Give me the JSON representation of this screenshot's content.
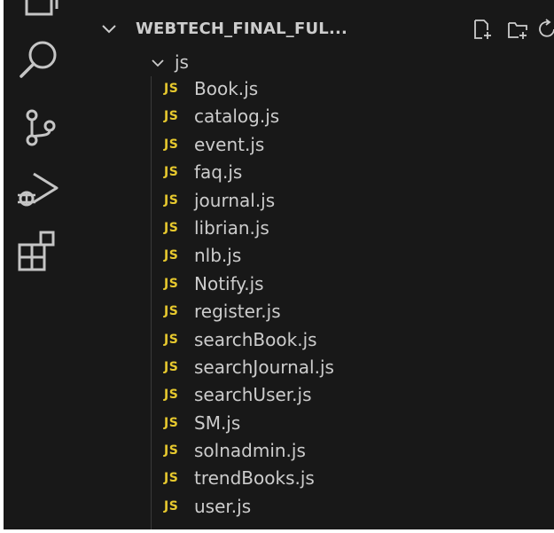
{
  "activity_bar": {
    "icons": [
      "files-icon",
      "search-icon",
      "source-control-icon",
      "run-debug-icon",
      "extensions-icon"
    ]
  },
  "explorer": {
    "section_title": "WEBTECH_FINAL_FUL...",
    "header_actions": [
      "new-file-icon",
      "new-folder-icon",
      "refresh-icon"
    ],
    "folder": {
      "name": "js",
      "expanded": true
    },
    "file_badge": "JS",
    "badge_color": "#e6c82e",
    "files": [
      {
        "name": "Book.js"
      },
      {
        "name": "catalog.js"
      },
      {
        "name": "event.js"
      },
      {
        "name": "faq.js"
      },
      {
        "name": "journal.js"
      },
      {
        "name": "librian.js"
      },
      {
        "name": "nlb.js"
      },
      {
        "name": "Notify.js"
      },
      {
        "name": "register.js"
      },
      {
        "name": "searchBook.js"
      },
      {
        "name": "searchJournal.js"
      },
      {
        "name": "searchUser.js"
      },
      {
        "name": "SM.js"
      },
      {
        "name": "solnadmin.js"
      },
      {
        "name": "trendBooks.js"
      },
      {
        "name": "user.js"
      }
    ]
  },
  "colors": {
    "background": "#181818",
    "text": "#cccccc",
    "icon": "#c5c5c5"
  }
}
